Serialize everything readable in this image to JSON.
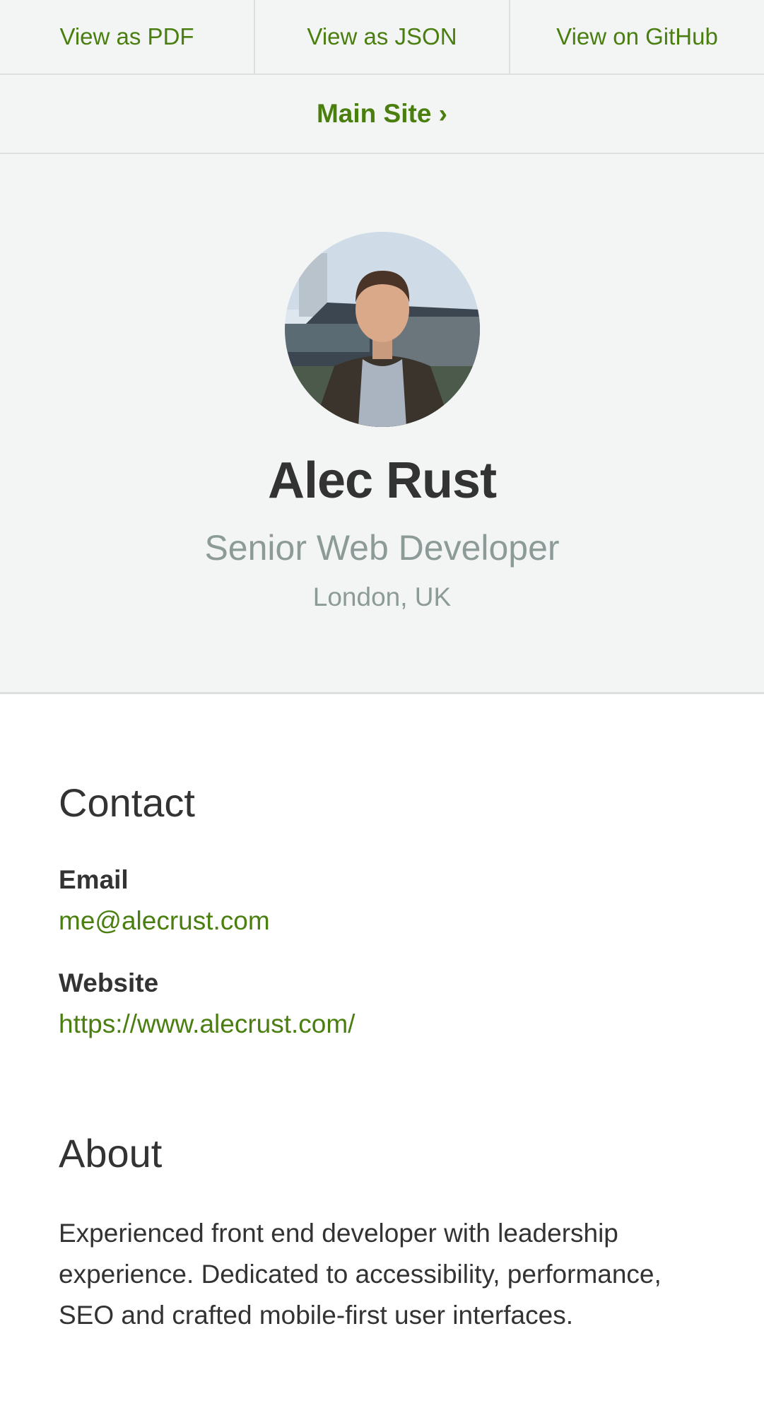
{
  "topnav": {
    "pdf": "View as PDF",
    "json": "View as JSON",
    "github": "View on GitHub"
  },
  "mainsite": {
    "label": "Main Site ›"
  },
  "profile": {
    "name": "Alec Rust",
    "title": "Senior Web Developer",
    "location": "London, UK"
  },
  "contact": {
    "heading": "Contact",
    "email_label": "Email",
    "email_value": "me@alecrust.com",
    "website_label": "Website",
    "website_value": "https://www.alecrust.com/"
  },
  "about": {
    "heading": "About",
    "text": "Experienced front end developer with leadership experience. Dedicated to accessibility, performance, SEO and crafted mobile-first user interfaces."
  },
  "colors": {
    "link": "#4a7f10",
    "muted": "#8d9b98",
    "text": "#333333",
    "panel": "#f3f5f4"
  }
}
